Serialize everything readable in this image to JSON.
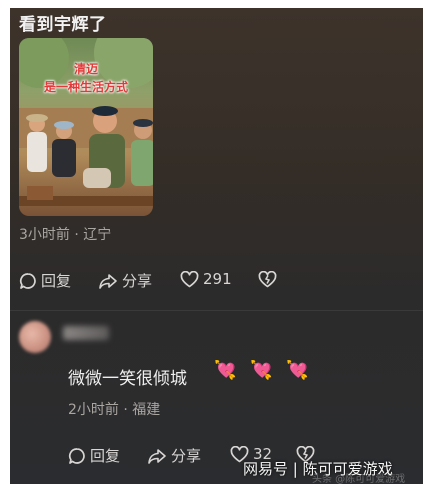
{
  "post": {
    "title": "看到宇辉了",
    "photo_caption_line1": "清迈",
    "photo_caption_line2": "是一种生活方式",
    "meta": "3小时前 · 辽宁",
    "actions": {
      "reply": "回复",
      "share": "分享",
      "likes": "291"
    }
  },
  "reply": {
    "text": "微微一笑很倾城",
    "emojis": [
      "💘",
      "💘",
      "💘"
    ],
    "meta": "2小时前 · 福建",
    "actions": {
      "reply": "回复",
      "share": "分享",
      "likes": "32"
    }
  },
  "watermark": {
    "brand": "网易号",
    "account": "陈可可爱游戏",
    "faint": "头条 @陈可可爱游戏"
  },
  "icons": {
    "reply": "comment-bubble-icon",
    "share": "share-arrow-icon",
    "like": "heart-outline-icon",
    "dislike": "broken-heart-icon"
  }
}
